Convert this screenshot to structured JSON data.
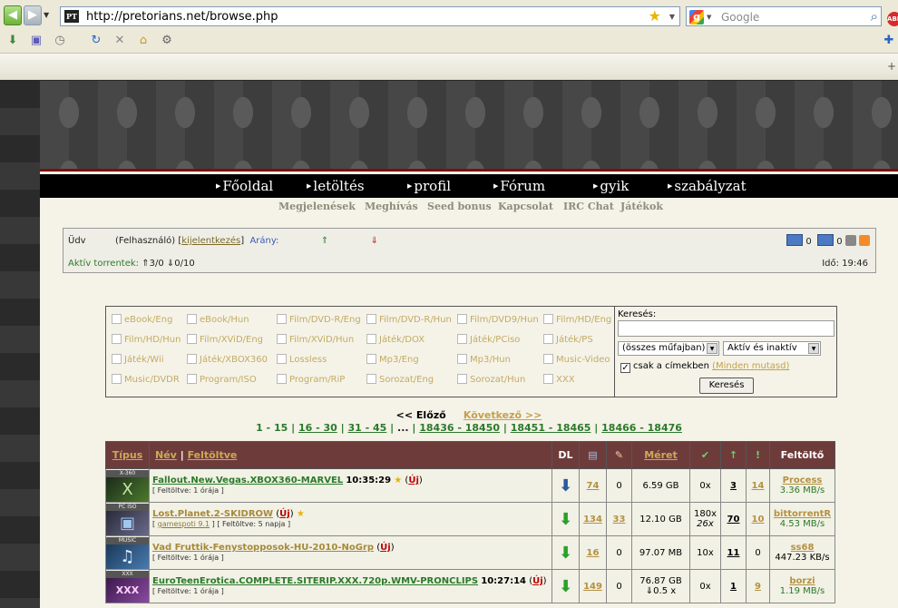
{
  "browser": {
    "url": "http://pretorians.net/browse.php",
    "favicon_text": "PT",
    "search_placeholder": "Google",
    "abp_label": "ABP"
  },
  "nav": {
    "main": [
      "Főoldal",
      "letöltés",
      "profil",
      "Fórum",
      "gyik",
      "szabályzat"
    ],
    "sub": [
      "Megjelenések",
      "Meghívás",
      "Seed bonus",
      "Kapcsolat",
      "IRC Chat",
      "Játékok"
    ]
  },
  "infobox": {
    "greeting": "Üdv",
    "role": "(Felhasználó)",
    "logout": "kijelentkezés",
    "ratio_label": "Arány:",
    "active_label": "Aktív torrentek:",
    "active_up": "3/0",
    "active_down": "0/10",
    "time_label": "Idő:",
    "time": "19:46",
    "msg1": "0",
    "msg2": "0"
  },
  "categories": [
    [
      "eBook/Eng",
      "eBook/Hun",
      "Film/DVD-R/Eng",
      "Film/DVD-R/Hun",
      "Film/DVD9/Hun",
      "Film/HD/Eng"
    ],
    [
      "Film/HD/Hun",
      "Film/XViD/Eng",
      "Film/XViD/Hun",
      "Játék/DOX",
      "Játék/PCiso",
      "Játék/PS"
    ],
    [
      "Játék/Wii",
      "Játék/XBOX360",
      "Lossless",
      "Mp3/Eng",
      "Mp3/Hun",
      "Music-Video"
    ],
    [
      "Music/DVDR",
      "Program/ISO",
      "Program/RiP",
      "Sorozat/Eng",
      "Sorozat/Hun",
      "XXX"
    ]
  ],
  "search": {
    "label": "Keresés:",
    "genre": "(összes műfajban)",
    "status": "Aktív és inaktív",
    "titles_only": "csak a címekben",
    "show_all": "(Minden mutasd)",
    "button": "Keresés"
  },
  "pager": {
    "prev": "<< Előző",
    "next": "Következő >>",
    "current": "1 - 15",
    "links": [
      "16 - 30",
      "31 - 45"
    ],
    "ellipsis": "...",
    "tail": [
      "18436 - 18450",
      "18451 - 18465",
      "18466 - 18476"
    ]
  },
  "table": {
    "headers": {
      "type": "Típus",
      "name": "Név",
      "uploaded": "Feltöltve",
      "dl": "DL",
      "size": "Méret",
      "uploader": "Feltöltő"
    },
    "rows": [
      {
        "badge": "X-360",
        "icon": "X",
        "name": "Fallout.New.Vegas.XBOX360-MARVEL",
        "time": "10:35:29",
        "new": "Új",
        "sub": "[ Feltöltve: 1 órája ]",
        "comments": "74",
        "files": "0",
        "size": "6.59 GB",
        "size2": "",
        "ratio": "0x",
        "ratio2": "",
        "seed": "3",
        "leech": "14",
        "uploader": "Process",
        "speed": "3.36 MB/s"
      },
      {
        "badge": "PC ISO",
        "icon": "▣",
        "name": "Lost.Planet.2-SKIDROW",
        "time": "",
        "new": "Új",
        "sub_link": "gamespoti 9.1",
        "sub": "[ Feltöltve: 5 napja ]",
        "comments": "134",
        "files": "33",
        "size": "12.10 GB",
        "size2": "",
        "ratio": "180x",
        "ratio2": "26x",
        "seed": "70",
        "leech": "10",
        "uploader": "bittorrentR",
        "speed": "4.53 MB/s"
      },
      {
        "badge": "MUSIC",
        "icon": "♫",
        "name": "Vad Fruttik-Fenystopposok-HU-2010-NoGrp",
        "time": "",
        "new": "Új",
        "sub": "[ Feltöltve: 1 órája ]",
        "comments": "16",
        "files": "0",
        "size": "97.07 MB",
        "size2": "",
        "ratio": "10x",
        "ratio2": "",
        "seed": "11",
        "leech": "0",
        "uploader": "ss68",
        "speed": "447.23 KB/s"
      },
      {
        "badge": "XXX",
        "icon": "XXX",
        "name": "EuroTeenErotica.COMPLETE.SITERIP.XXX.720p.WMV-PRONCLIPS",
        "time": "10:27:14",
        "new": "Új",
        "sub": "[ Feltöltve: 1 órája ]",
        "comments": "149",
        "files": "0",
        "size": "76.87 GB",
        "size2": "⇓0.5 x",
        "ratio": "0x",
        "ratio2": "",
        "seed": "1",
        "leech": "9",
        "uploader": "borzi",
        "speed": "1.19 MB/s"
      }
    ]
  }
}
